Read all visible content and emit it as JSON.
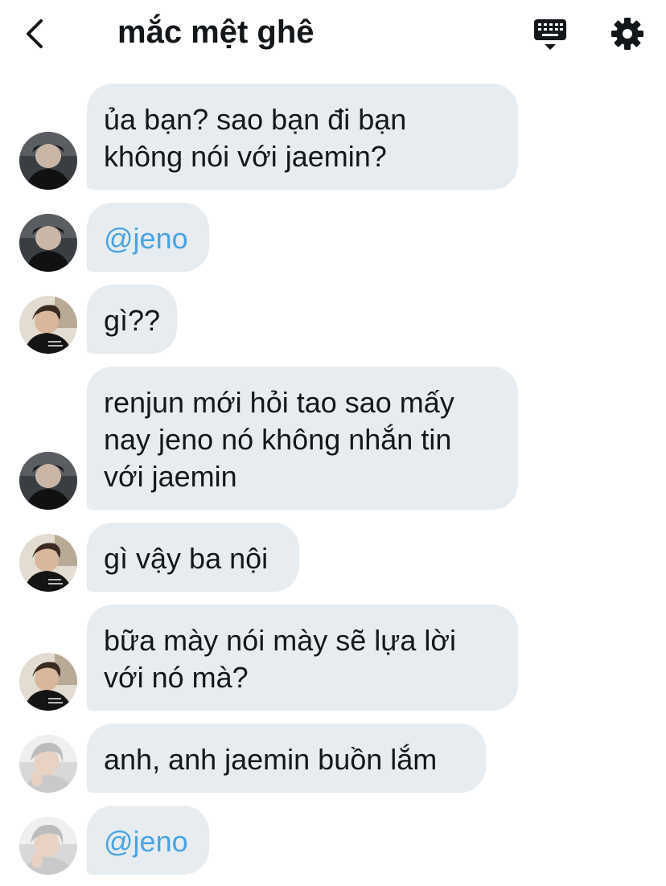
{
  "header": {
    "title": "mắc mệt ghê",
    "back_icon": "chevron-left-icon",
    "keyboard_icon": "keyboard-icon",
    "settings_icon": "gear-icon"
  },
  "colors": {
    "bubble_bg": "#e6ecf0",
    "mention": "#4aa3e0",
    "text": "#14171a"
  },
  "messages": [
    {
      "sender": "a",
      "lines": [
        "ủa bạn? sao bạn đi bạn",
        "không nói với jaemin?"
      ],
      "mention": false
    },
    {
      "sender": "a",
      "lines": [
        "@jeno"
      ],
      "mention": true
    },
    {
      "sender": "b",
      "lines": [
        "gì??"
      ],
      "mention": false
    },
    {
      "sender": "a",
      "lines": [
        "renjun mới hỏi tao sao mấy",
        "nay jeno nó không nhắn tin",
        "với jaemin"
      ],
      "mention": false
    },
    {
      "sender": "b",
      "lines": [
        "gì vậy ba nội"
      ],
      "mention": false
    },
    {
      "sender": "a",
      "lines": [
        "bữa mày nói mày sẽ lựa lời",
        "với nó mà?"
      ],
      "mention": false
    },
    {
      "sender": "c",
      "lines": [
        "anh, anh jaemin buồn lắm"
      ],
      "mention": false
    },
    {
      "sender": "c",
      "lines": [
        "@jeno"
      ],
      "mention": true
    }
  ]
}
